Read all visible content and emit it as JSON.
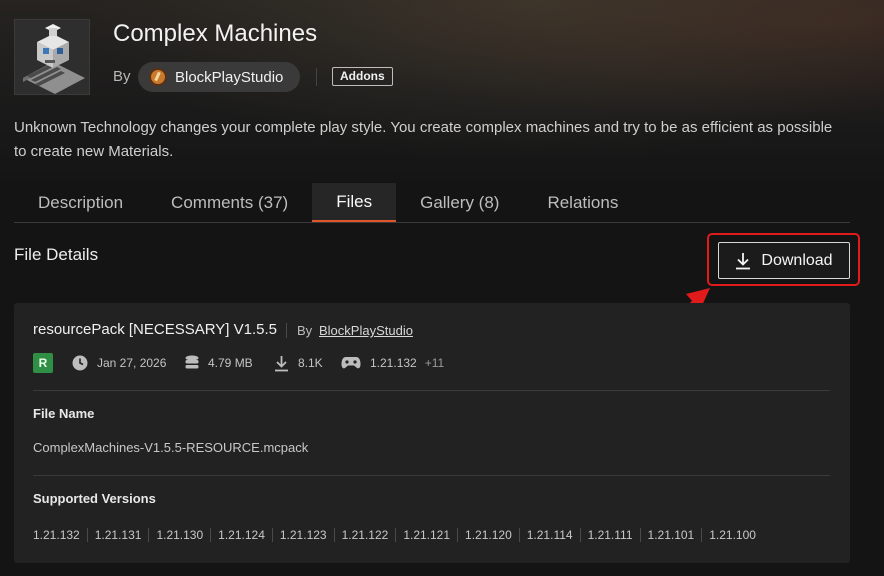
{
  "project": {
    "title": "Complex Machines",
    "by_label": "By",
    "author": "BlockPlayStudio",
    "category_badge": "Addons",
    "summary": "Unknown Technology changes your complete play style. You create complex machines and try to be as efficient as possible to create new Materials."
  },
  "tabs": [
    {
      "label": "Description",
      "active": false
    },
    {
      "label": "Comments (37)",
      "active": false
    },
    {
      "label": "Files",
      "active": true
    },
    {
      "label": "Gallery (8)",
      "active": false
    },
    {
      "label": "Relations",
      "active": false
    }
  ],
  "file_section": {
    "title": "File Details",
    "download_label": "Download"
  },
  "file": {
    "display_name": "resourcePack [NECESSARY] V1.5.5",
    "by_label": "By",
    "author": "BlockPlayStudio",
    "release_type": "R",
    "date": "Jan 27, 2026",
    "size": "4.79 MB",
    "downloads": "8.1K",
    "game_version": "1.21.132",
    "game_version_more": "+11",
    "file_name_label": "File Name",
    "file_name": "ComplexMachines-V1.5.5-RESOURCE.mcpack",
    "supported_versions_label": "Supported Versions",
    "supported_versions": [
      "1.21.132",
      "1.21.131",
      "1.21.130",
      "1.21.124",
      "1.21.123",
      "1.21.122",
      "1.21.121",
      "1.21.120",
      "1.21.114",
      "1.21.111",
      "1.21.101",
      "1.21.100"
    ]
  },
  "icons": {
    "date": "clock-icon",
    "size": "database-icon",
    "downloads": "download-icon",
    "game_version": "gamepad-icon"
  },
  "colors": {
    "accent": "#e0552c",
    "annotation": "#e11b1b",
    "release_green": "#2f8f44"
  }
}
